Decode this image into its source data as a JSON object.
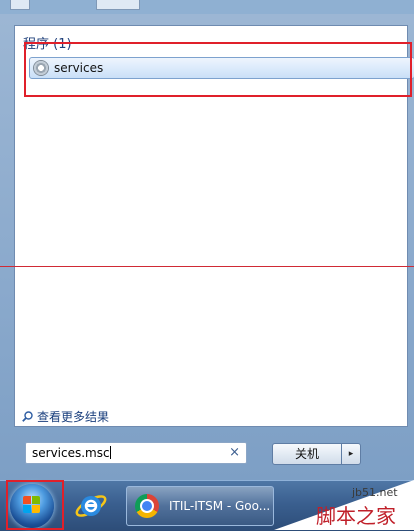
{
  "results": {
    "section_header": "程序 (1)",
    "items": [
      {
        "label": "services",
        "icon": "services-gear-icon"
      }
    ]
  },
  "see_more": {
    "label": "查看更多结果",
    "icon": "search-magnifier-icon"
  },
  "search": {
    "value": "services.msc",
    "clear_icon": "clear-x-icon"
  },
  "shutdown": {
    "label": "关机",
    "arrow": "▸"
  },
  "taskbar": {
    "start_icon": "windows-start-orb-icon",
    "pinned": [
      {
        "icon": "internet-explorer-icon"
      }
    ],
    "tasks": [
      {
        "label": "ITIL-ITSM - Goo...",
        "icon": "chrome-icon"
      }
    ]
  },
  "watermark": {
    "site": "jb51.net",
    "text": "脚本之家"
  },
  "colors": {
    "highlight": "#e0202a",
    "taskbar": "#3a5f8f",
    "selection": "#dcebfb"
  }
}
